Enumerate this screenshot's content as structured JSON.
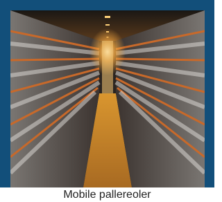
{
  "caption": "Mobile pallereoler",
  "colors": {
    "frame": "#124f7a",
    "caption_text": "#222222"
  }
}
